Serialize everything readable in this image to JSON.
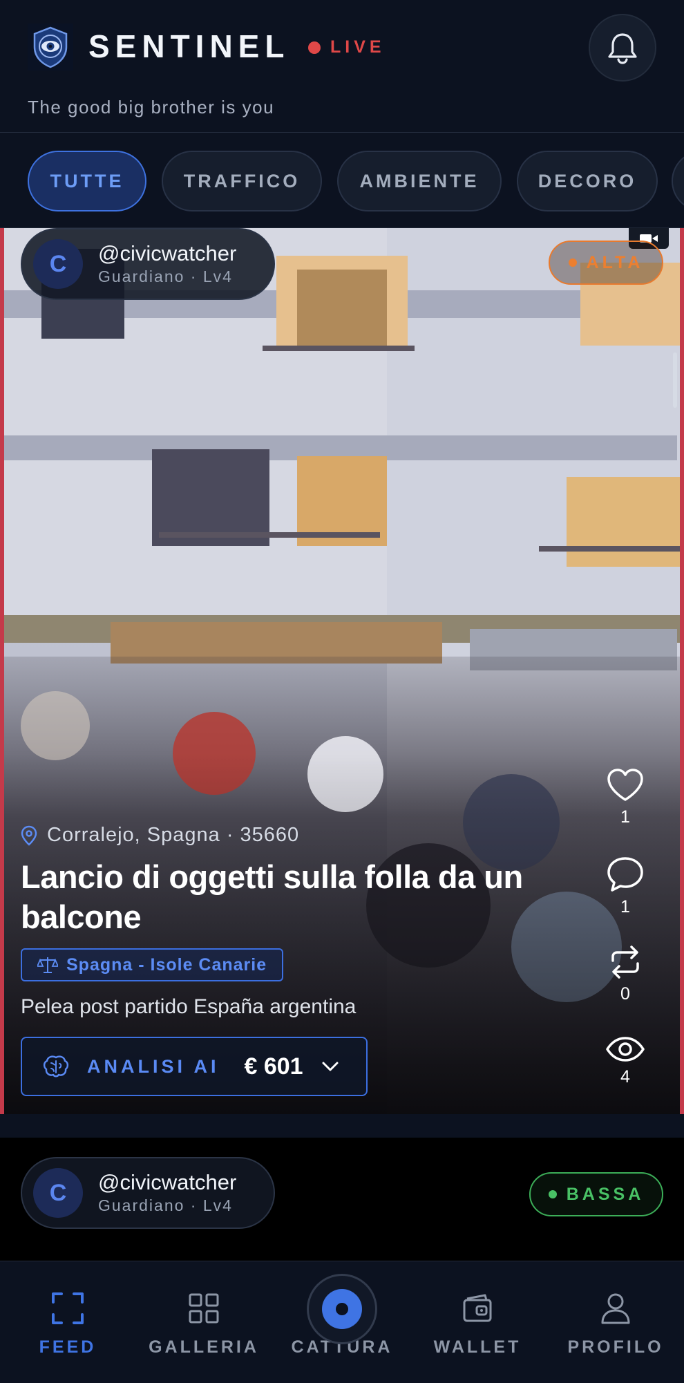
{
  "header": {
    "brand": "SENTINEL",
    "live_label": "LIVE",
    "tagline": "The good big brother is you"
  },
  "tabs": [
    {
      "label": "TUTTE",
      "active": true
    },
    {
      "label": "TRAFFICO",
      "active": false
    },
    {
      "label": "AMBIENTE",
      "active": false
    },
    {
      "label": "DECORO",
      "active": false
    }
  ],
  "posts": [
    {
      "avatar_initial": "C",
      "handle": "@civicwatcher",
      "rank": "Guardiano · Lv4",
      "severity": "ALTA",
      "location": "Corralejo, Spagna · 35660",
      "title": "Lancio di oggetti sulla folla da un balcone",
      "law_tag": "Spagna - Isole Canarie",
      "description": "Pelea post partido España argentina",
      "ai_label": "ANALISI AI",
      "ai_amount": "€ 601",
      "likes": "1",
      "comments": "1",
      "reposts": "0",
      "views": "4"
    },
    {
      "avatar_initial": "C",
      "handle": "@civicwatcher",
      "rank": "Guardiano · Lv4",
      "severity": "BASSA"
    }
  ],
  "nav": [
    {
      "label": "FEED",
      "icon": "scan-frame-icon",
      "active": true
    },
    {
      "label": "GALLERIA",
      "icon": "grid-icon",
      "active": false
    },
    {
      "label": "CATTURA",
      "icon": "capture-icon",
      "active": false
    },
    {
      "label": "WALLET",
      "icon": "wallet-icon",
      "active": false
    },
    {
      "label": "PROFILO",
      "icon": "user-icon",
      "active": false
    }
  ],
  "colors": {
    "accent": "#3f74e4",
    "live": "#e04848",
    "severity_high": "#e87a2e",
    "severity_low": "#3cae58",
    "background": "#0c1220"
  }
}
